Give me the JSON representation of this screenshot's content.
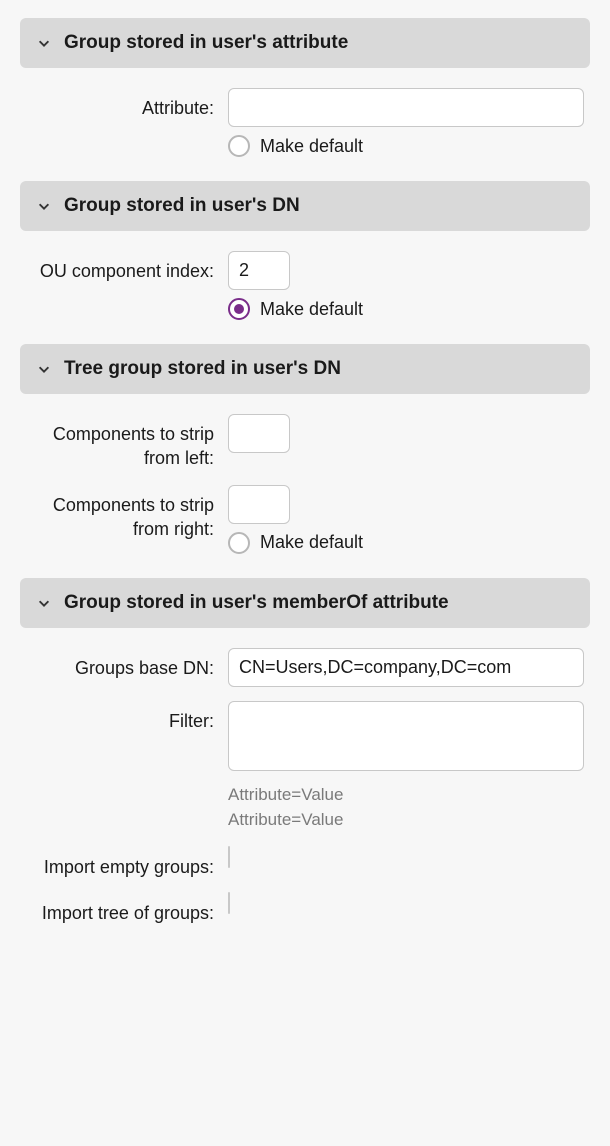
{
  "colors": {
    "accent": "#7a2d8a"
  },
  "sections": {
    "attr": {
      "title": "Group stored in user's attribute",
      "fields": {
        "attribute_label": "Attribute:",
        "attribute_value": "",
        "make_default_label": "Make default",
        "make_default_checked": false
      }
    },
    "dn": {
      "title": "Group stored in user's DN",
      "fields": {
        "ou_index_label": "OU component index:",
        "ou_index_value": "2",
        "make_default_label": "Make default",
        "make_default_checked": true
      }
    },
    "tree": {
      "title": "Tree group stored in user's DN",
      "fields": {
        "strip_left_label": "Components to strip from left:",
        "strip_left_value": "",
        "strip_right_label": "Components to strip from right:",
        "strip_right_value": "",
        "strip_right_disabled": true,
        "make_default_label": "Make default",
        "make_default_checked": false
      }
    },
    "memberof": {
      "title": "Group stored in user's memberOf attribute",
      "fields": {
        "base_dn_label": "Groups base DN:",
        "base_dn_value": "CN=Users,DC=company,DC=com",
        "filter_label": "Filter:",
        "filter_value": "",
        "filter_hint": "Attribute=Value\nAttribute=Value",
        "import_empty_label": "Import empty groups:",
        "import_empty_checked": false,
        "import_tree_label": "Import tree of groups:",
        "import_tree_checked": false
      }
    }
  }
}
